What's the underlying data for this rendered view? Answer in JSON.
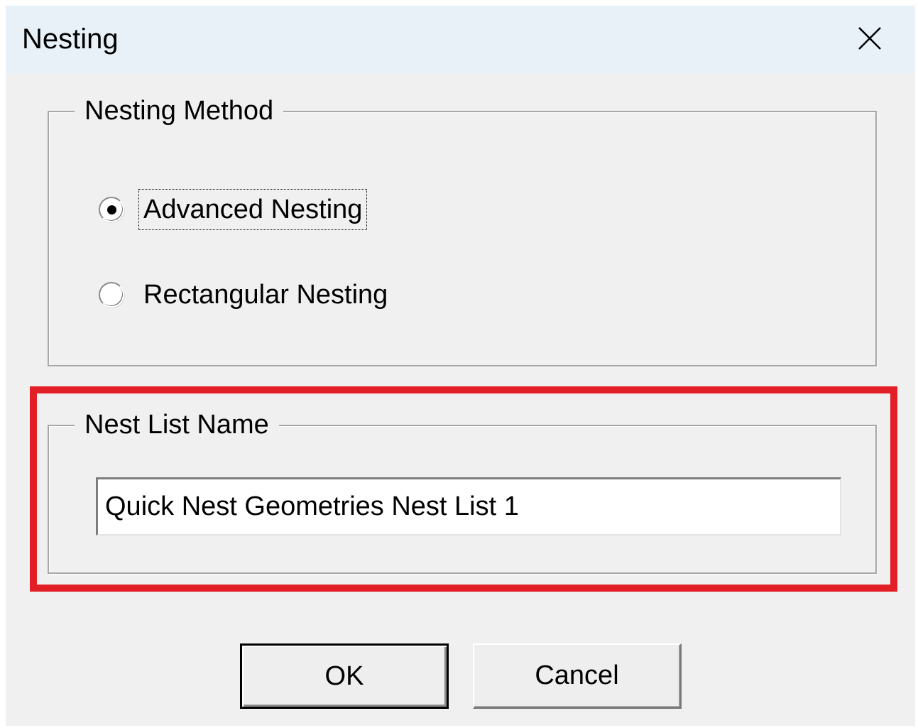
{
  "window": {
    "title": "Nesting",
    "close_icon": "close-icon"
  },
  "nesting_method": {
    "legend": "Nesting Method",
    "options": [
      {
        "label": "Advanced Nesting",
        "selected": true,
        "focused": true
      },
      {
        "label": "Rectangular Nesting",
        "selected": false,
        "focused": false
      }
    ]
  },
  "nest_list_name": {
    "legend": "Nest List Name",
    "value": "Quick Nest Geometries Nest List 1",
    "highlight_color": "#e21f26"
  },
  "buttons": {
    "ok_label": "OK",
    "cancel_label": "Cancel"
  },
  "colors": {
    "dialog_background": "#f0f0f0",
    "titlebar_background": "#e8f1f8",
    "highlight": "#e21f26"
  }
}
